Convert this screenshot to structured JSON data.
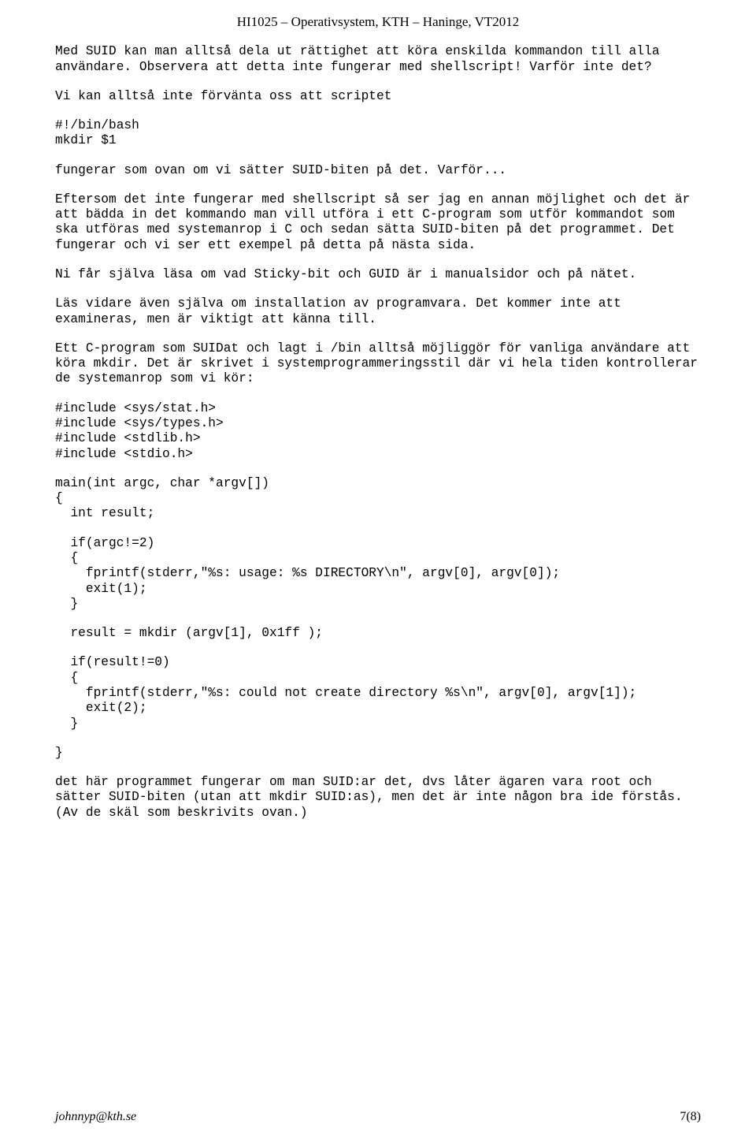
{
  "header": "HI1025 – Operativsystem, KTH – Haninge, VT2012",
  "p1": "Med SUID kan man alltså dela ut rättighet att köra enskilda kommandon till alla användare. Observera att detta inte fungerar med shellscript! Varför inte det?",
  "p2": "Vi kan alltså inte förvänta oss att scriptet",
  "p3": "#!/bin/bash\nmkdir $1",
  "p4": "fungerar som ovan om vi sätter SUID-biten på det. Varför...",
  "p5": "Eftersom det inte fungerar med shellscript så ser jag en annan möjlighet och det är att bädda in det kommando man vill utföra i ett C-program som utför kommandot som ska utföras med systemanrop i C och sedan sätta SUID-biten på det programmet. Det fungerar och vi ser ett exempel på detta på nästa sida.",
  "p6": "Ni får själva läsa om vad Sticky-bit och GUID är i manualsidor och på nätet.",
  "p7": "Läs vidare även själva om installation av programvara. Det kommer inte att examineras, men är viktigt att känna till.",
  "p8": "Ett C-program som SUIDat och lagt i /bin alltså möjliggör för vanliga användare att köra mkdir. Det är skrivet i systemprogrammeringsstil där vi hela tiden kontrollerar de systemanrop som vi kör:",
  "code1": "#include <sys/stat.h>\n#include <sys/types.h>\n#include <stdlib.h>\n#include <stdio.h>",
  "code2": "main(int argc, char *argv[])\n{\n  int result;",
  "code3": "  if(argc!=2)\n  {\n    fprintf(stderr,\"%s: usage: %s DIRECTORY\\n\", argv[0], argv[0]);\n    exit(1);\n  }",
  "code4": "  result = mkdir (argv[1], 0x1ff );",
  "code5": "  if(result!=0)\n  {\n    fprintf(stderr,\"%s: could not create directory %s\\n\", argv[0], argv[1]);\n    exit(2);\n  }",
  "code6": "}",
  "p9": "det här programmet fungerar om man SUID:ar det, dvs låter ägaren vara root och sätter SUID-biten (utan att mkdir SUID:as), men det är inte någon bra ide förstås. (Av de skäl som beskrivits ovan.)",
  "footer_left": "johnnyp@kth.se",
  "footer_right": "7(8)"
}
